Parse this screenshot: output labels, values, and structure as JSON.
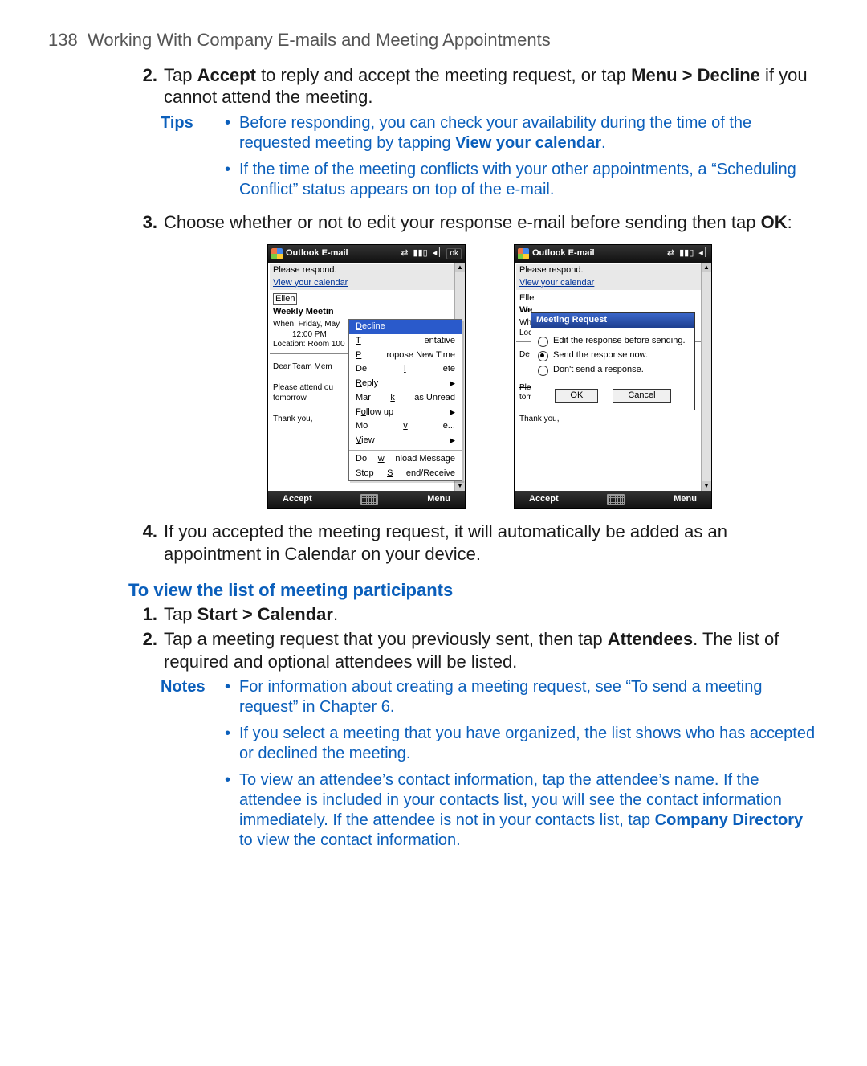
{
  "header": {
    "page_number": "138",
    "chapter_title": "Working With Company E-mails and Meeting Appointments"
  },
  "steps_a": {
    "s2_num": "2.",
    "s2_t1": "Tap ",
    "s2_b1": "Accept",
    "s2_t2": " to reply and accept the meeting request, or tap ",
    "s2_b2": "Menu > Decline",
    "s2_t3": " if you cannot attend the meeting.",
    "s3_num": "3.",
    "s3_t1": "Choose whether or not to edit your response e-mail before sending then tap ",
    "s3_b1": "OK",
    "s3_t2": ":",
    "s4_num": "4.",
    "s4_text": "If you accepted the meeting request, it will automatically be added as an appointment in Calendar on your device."
  },
  "tips": {
    "label": "Tips",
    "t1a": "Before responding, you can check your availability during the time of the requested meeting by tapping ",
    "t1b": "View your calendar",
    "t1c": ".",
    "t2": "If the time of the meeting conflicts with your other appointments, a “Scheduling Conflict” status appears on top of the e-mail."
  },
  "section2": {
    "heading": "To view the list of meeting participants",
    "s1_num": "1.",
    "s1_t1": "Tap ",
    "s1_b1": "Start > Calendar",
    "s1_t2": ".",
    "s2_num": "2.",
    "s2_t1": "Tap a meeting request that you previously sent, then tap ",
    "s2_b1": "Attendees",
    "s2_t2": ". The list of required and optional attendees will be listed."
  },
  "notes": {
    "label": "Notes",
    "n1": "For information about creating a meeting request, see “To send a meeting request” in Chapter 6.",
    "n2": "If you select a meeting that you have organized, the list shows who has accepted or declined the meeting.",
    "n3a": "To view an attendee’s contact information, tap the attendee’s name. If the attendee is included in your contacts list, you will see the contact information immediately. If the attendee is not in your contacts list, tap ",
    "n3b": "Company Directory",
    "n3c": " to view the contact information."
  },
  "shot_common": {
    "titlebar": "Outlook E-mail",
    "ok": "ok",
    "please_respond": "Please respond.",
    "view_cal": "View your calendar",
    "from_label": "Ellen",
    "subject": "Weekly Meetin",
    "when": "When: Friday, May",
    "time": "12:00 PM",
    "location": "Location: Room 100",
    "dear": "Dear Team Mem",
    "please_attend": "Please attend ou",
    "please_attend_full": "Please attend our weekly meeting",
    "tomorrow": "tomorrow.",
    "thank_you": "Thank you,",
    "soft_left": "Accept",
    "soft_right": "Menu"
  },
  "ctx": {
    "decline": "Decline",
    "tentative": "Tentative",
    "propose": "Propose New Time",
    "delete": "Delete",
    "reply": "Reply",
    "mark_unread": "Mark as Unread",
    "follow": "Follow up",
    "move": "Move...",
    "view": "View",
    "download": "Download Message",
    "stop": "Stop Send/Receive"
  },
  "dialog": {
    "title": "Meeting Request",
    "r1": "Edit the response before sending.",
    "r2": "Send the response now.",
    "r3": "Don't send a response.",
    "ok": "OK",
    "cancel": "Cancel"
  },
  "shot_right": {
    "from_label": "Elle",
    "subject": "We",
    "when": "Wh",
    "location": "Loc",
    "dear": "De"
  }
}
